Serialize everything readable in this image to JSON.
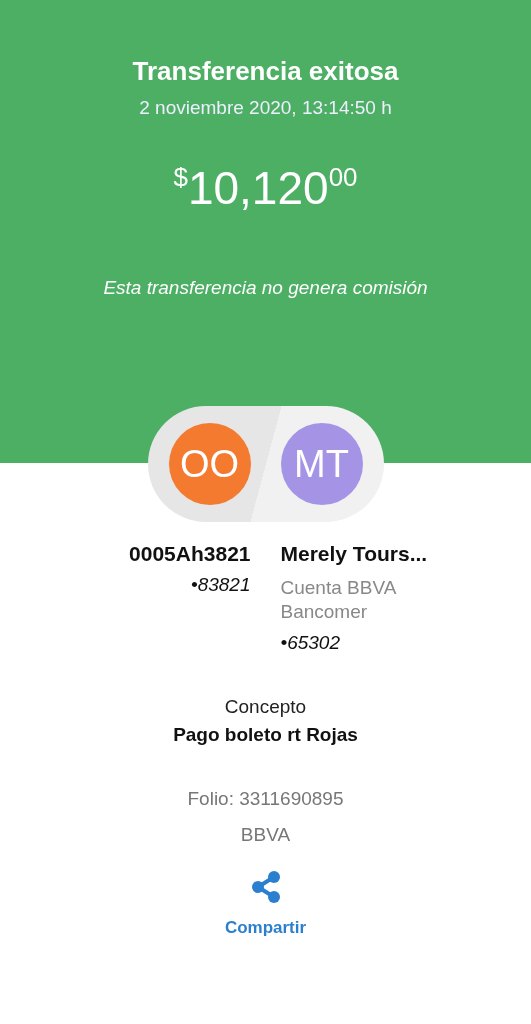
{
  "header": {
    "title": "Transferencia exitosa",
    "date": "2 noviembre 2020, 13:14:50 h",
    "amount": {
      "currency": "$",
      "integer": "10,120",
      "cents": "00"
    },
    "note": "Esta transferencia no genera comisión"
  },
  "parties": [
    {
      "initials": "OO",
      "color": "#f47a30",
      "name": "0005Ah3821",
      "account": "•83821"
    },
    {
      "initials": "MT",
      "color": "#a594e6",
      "name": "Merely Tours...",
      "details": [
        "Cuenta BBVA",
        "Bancomer"
      ],
      "account": "•65302"
    }
  ],
  "concept": {
    "label": "Concepto",
    "value": "Pago boleto rt Rojas"
  },
  "folio": "Folio: 3311690895",
  "bank": "BBVA",
  "share": {
    "label": "Compartir"
  }
}
